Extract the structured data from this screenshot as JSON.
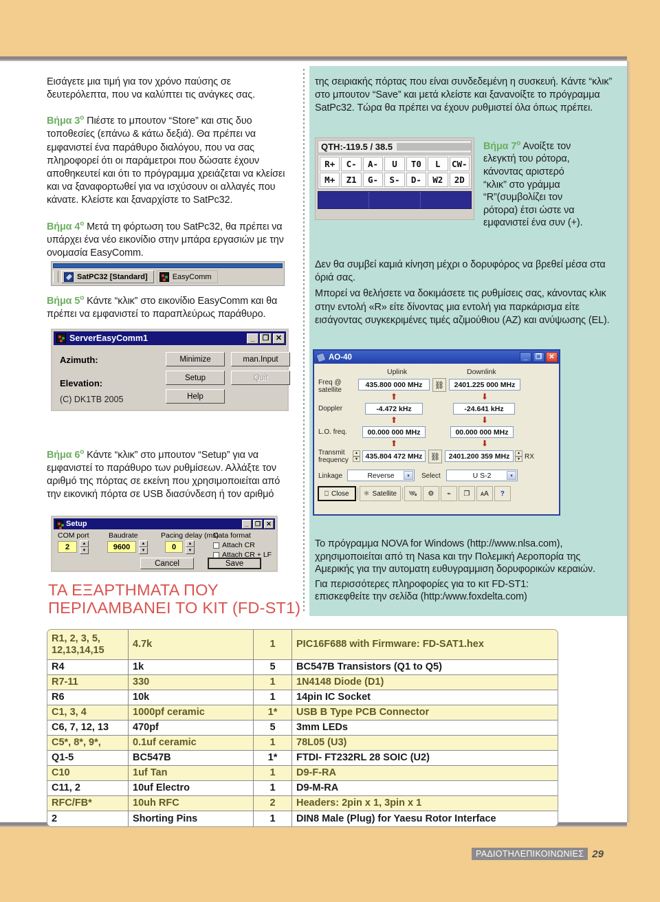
{
  "left_column": {
    "intro": "Εισάγετε μια τιμή για  τον χρόνο παύσης σε δευτερόλεπτα, που να καλύπτει τις ανάγκες σας.",
    "step3_label": "Βήμα 3",
    "step3_sup": "ο",
    "step3_text": "Πιέστε το μπουτον “Store” και στις δυο τοποθεσίες (επάνω & κάτω δεξιά). Θα πρέπει να εμφανιστεί ένα παράθυρο διαλόγου, που να σας πληροφορεί ότι οι παράμετροι που δώσατε έχουν αποθηκευτεί και ότι το πρόγραμμα χρειάζεται να κλείσει και να ξαναφορτωθεί για να ισχύσουν οι αλλαγές που κάνατε. Κλείστε και ξαναρχίστε το SatPc32.",
    "step4_label": "Βήμα 4",
    "step4_sup": "ο",
    "step4_text": "Μετά τη φόρτωση του SatPc32, θα πρέπει να υπάρχει ένα νέο εικονίδιο στην μπάρα εργασιών με την ονομασία EasyComm.",
    "step5_label": "Βήμα 5",
    "step5_sup": "ο",
    "step5_text": "Κάντε “κλικ” στο εικονίδιο EasyComm και θα πρέπει να εμφανιστεί το παραπλεύρως παράθυρο.",
    "step6_label": "Βήμα 6",
    "step6_sup": "ο",
    "step6_text": "Κάντε “κλικ” στο μπουτον “Setup” για να εμφανιστεί το παράθυρο των ρυθμίσεων. Αλλάξτε τον αριθμό της πόρτας σε εκείνη που χρησιμοποιείται από την εικονική πόρτα σε USB διασύνδεση ή τον αριθμό"
  },
  "right_column": {
    "para1": "της σειριακής πόρτας που είναι συνδεδεμένη η συσκευή. Κάντε “κλικ” στο μπουτον “Save” και μετά κλείστε και ξανανοίξτε το πρόγραμμα SatPc32. Τώρα θα πρέπει να έχουν ρυθμιστεί όλα όπως πρέπει.",
    "step7_label": "Βήμα 7",
    "step7_sup": "ο",
    "step7_text": "Ανοίξτε τον ελεγκτή του ρότορα, κάνοντας αριστερό “κλικ” στο γράμμα “R”(συμβολίζει τον ρότορα) έτσι ώστε να εμφανιστεί ένα συν (+).",
    "para2": "Δεν θα συμβεί καμιά κίνηση μέχρι ο δορυφόρος να βρεθεί μέσα στα όριά σας.",
    "para3": "Μπορεί να θελήσετε να δοκιμάσετε τις ρυθμίσεις σας, κάνοντας κλικ στην εντολή «R» είτε δίνοντας μια εντολή για παρκάρισμα είτε εισάγοντας συγκεκριμένες τιμές αζιμούθιου (AZ) και ανύψωσης (EL).",
    "nova_text": "Το πρόγραμμα NOVA for Windows (http://www.nlsa.com), χρησιμοποιείται από τη Nasa και την Πολεμική Αεροπορία της Αμερικής για την αυτοματη ευθυγραμμιση δορυφορικών κεραιών.",
    "foxdelta_line1": "Για περισσότερες πληροφορίες για το κιτ FD-ST1:",
    "foxdelta_line2": "επισκεφθείτε την σελίδα (http:/www.foxdelta.com)"
  },
  "taskbar": {
    "item1": "SatPC32 [Standard]",
    "item2": "EasyComm"
  },
  "server_window": {
    "title": "ServerEasyComm1",
    "minimize_glyph": "_",
    "maximize_glyph": "❐",
    "close_glyph": "✕",
    "azimuth_label": "Azimuth:",
    "elevation_label": "Elevation:",
    "copyright": "(C) DK1TB 2005",
    "btn_minimize": "Minimize",
    "btn_setup": "Setup",
    "btn_help": "Help",
    "btn_maninput": "man.Input",
    "btn_quit": "Quit"
  },
  "setup_window": {
    "title": "Setup",
    "minimize_glyph": "_",
    "maximize_glyph": "❐",
    "close_glyph": "✕",
    "com_label": "COM port",
    "com_value": "2",
    "baud_label": "Baudrate",
    "baud_value": "9600",
    "pacing_label": "Pacing delay (ms)",
    "pacing_value": "0",
    "dataformat_label": "Data format",
    "attach_cr": "Attach CR",
    "attach_crlf": "Attach CR + LF",
    "btn_cancel": "Cancel",
    "btn_save": "Save",
    "up_glyph": "▲",
    "down_glyph": "▼"
  },
  "qth_widget": {
    "label": "QTH:-119.5 / 38.5",
    "row1": [
      "R+",
      "C-",
      "A-",
      "U",
      "T0",
      "L",
      "CW-"
    ],
    "row2": [
      "M+",
      "Z1",
      "G-",
      "S-",
      "D-",
      "W2",
      "2D"
    ]
  },
  "ao40_window": {
    "title": "AO-40",
    "minimize_glyph": "_",
    "restore_glyph": "❐",
    "close_glyph": "✕",
    "uplink_header": "Uplink",
    "downlink_header": "Downlink",
    "row_freq_label": "Freq @\nsatellite",
    "row_doppler_label": "Doppler",
    "row_lo_label": "L.O. freq.",
    "row_tx_label": "Transmit\nfrequency",
    "uplink_freq": "435.800 000 MHz",
    "downlink_freq": "2401.225 000 MHz",
    "uplink_doppler": "-4.472 kHz",
    "downlink_doppler": "-24.641 kHz",
    "uplink_lo": "00.000 000 MHz",
    "downlink_lo": "00.000 000 MHz",
    "uplink_tx": "435.804 472 MHz",
    "downlink_rx": "2401.200 359 MHz",
    "rx_label": "RX",
    "linkage_label": "Linkage",
    "linkage_value": "Reverse",
    "select_label": "Select",
    "select_value": "U S-2",
    "btn_close": "Close",
    "btn_satellite": "Satellite",
    "tool_icons": [
      "antenna-icon",
      "lock-icon",
      "step-icon",
      "window-icon",
      "font-icon",
      "help-icon"
    ],
    "arrow_up": "⬆",
    "arrow_down": "⬇",
    "chevron": "▾"
  },
  "kit_heading": {
    "line1": "ΤΑ ΕΞΑΡΤΗΜΑΤΑ ΠΟΥ",
    "line2": "ΠΕΡΙΛΑΜΒΑΝΕΙ ΤΟ ΚΙΤ (FD-ST1)"
  },
  "parts_table": {
    "rows": [
      [
        "R1, 2, 3, 5,\n12,13,14,15",
        "4.7k",
        "1",
        "PIC16F688 with Firmware: FD-SAT1.hex"
      ],
      [
        "R4",
        "1k",
        "5",
        "BC547B Transistors (Q1 to Q5)"
      ],
      [
        "R7-11",
        "330",
        "1",
        "1N4148 Diode (D1)"
      ],
      [
        "R6",
        "10k",
        "1",
        "14pin IC Socket"
      ],
      [
        "C1, 3, 4",
        "1000pf ceramic",
        "1*",
        "USB B Type PCB Connector"
      ],
      [
        "C6, 7, 12, 13",
        "470pf",
        "5",
        "3mm LEDs"
      ],
      [
        "C5*, 8*, 9*,",
        "0.1uf ceramic",
        "1",
        "78L05 (U3)"
      ],
      [
        "Q1-5",
        "BC547B",
        "1*",
        "FTDI- FT232RL 28 SOIC (U2)"
      ],
      [
        "C10",
        "1uf Tan",
        "1",
        "D9-F-RA"
      ],
      [
        "C11, 2",
        "10uf Electro",
        "1",
        "D9-M-RA"
      ],
      [
        "RFC/FB*",
        "10uh RFC",
        "2",
        "Headers: 2pin x 1,   3pin x 1"
      ],
      [
        "2",
        "Shorting Pins",
        "1",
        "DIN8 Male (Plug) for Yaesu Rotor Interface"
      ]
    ]
  },
  "footer": {
    "magazine": "ΡΑΔΙΟΤΗΛΕΠΙΚΟΙΝΩΝΙΕΣ",
    "page": "29"
  },
  "colors": {
    "page_orange": "#f2cd8e",
    "mint_panel": "#bcdfd7",
    "step_green": "#6cae60",
    "heading_red": "#d9534f",
    "table_yellow": "#fbf6c8"
  }
}
